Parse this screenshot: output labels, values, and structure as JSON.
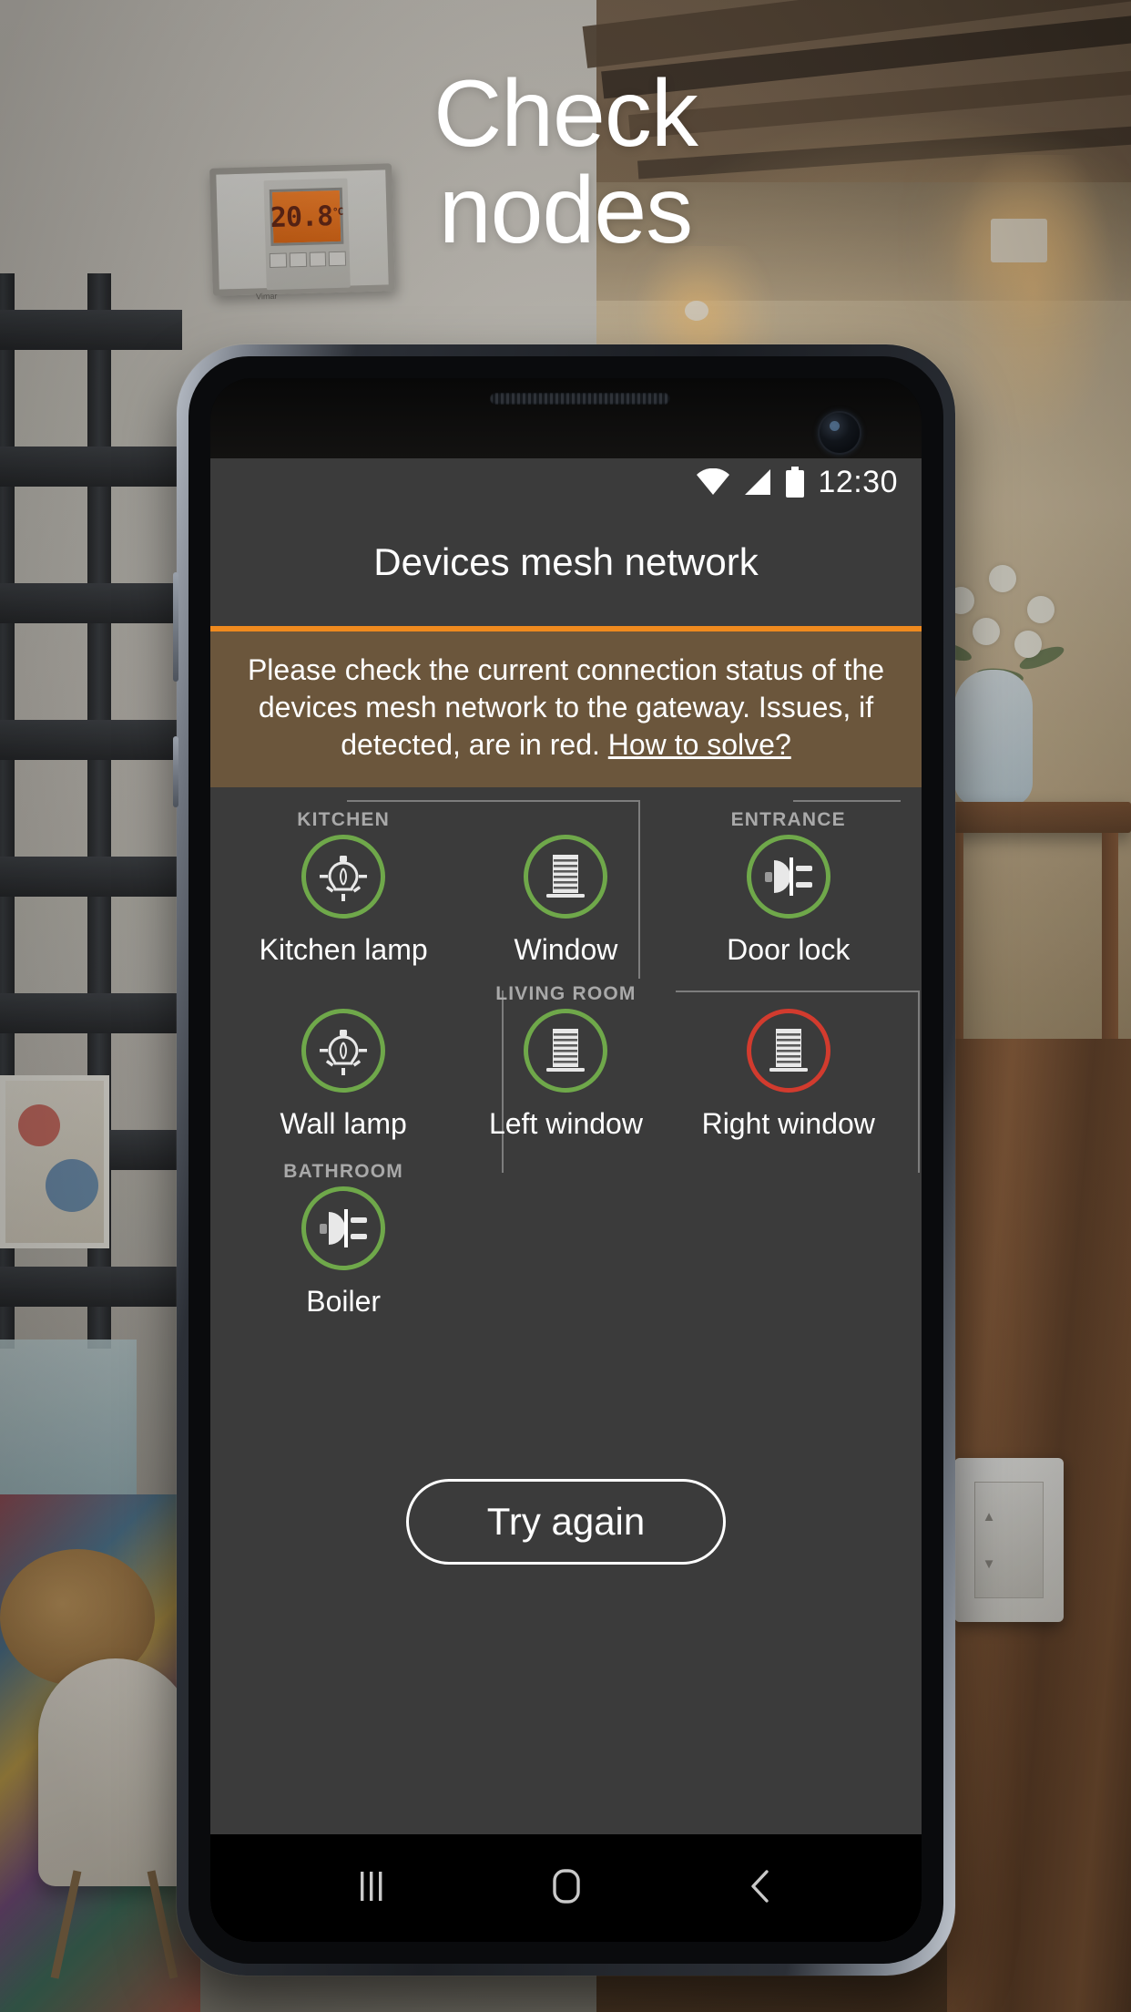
{
  "promo": {
    "headline_line1": "Check",
    "headline_line2": "nodes"
  },
  "background": {
    "thermostat_value": "20.8",
    "thermostat_unit": "°C",
    "thermostat_brand": "Vimar"
  },
  "phone": {
    "statusbar": {
      "wifi_icon": "wifi-icon",
      "signal_icon": "cell-signal-icon",
      "battery_icon": "battery-full-icon",
      "time": "12:30"
    },
    "app": {
      "title": "Devices mesh network",
      "banner": {
        "text": "Please check the current connection status of the devices mesh network to the gateway. Issues, if detected, are in red.",
        "link_label": "How to solve?",
        "accent_color": "#f08a1e",
        "background_color": "#6b563c"
      },
      "status_colors": {
        "ok": "#6fa84a",
        "error": "#d23b2e"
      },
      "groups": [
        {
          "name": "KITCHEN"
        },
        {
          "name": "ENTRANCE"
        },
        {
          "name": "LIVING ROOM"
        },
        {
          "name": "BATHROOM"
        }
      ],
      "nodes": [
        {
          "label": "Kitchen lamp",
          "icon": "bulb-icon",
          "status": "ok",
          "group": "KITCHEN"
        },
        {
          "label": "Window",
          "icon": "shutter-icon",
          "status": "ok",
          "group": "KITCHEN"
        },
        {
          "label": "Door lock",
          "icon": "plug-icon",
          "status": "ok",
          "group": "ENTRANCE"
        },
        {
          "label": "Wall lamp",
          "icon": "bulb-icon",
          "status": "ok",
          "group": ""
        },
        {
          "label": "Left window",
          "icon": "shutter-icon",
          "status": "ok",
          "group": "LIVING ROOM"
        },
        {
          "label": "Right window",
          "icon": "shutter-icon",
          "status": "error",
          "group": "LIVING ROOM"
        },
        {
          "label": "Boiler",
          "icon": "plug-icon",
          "status": "ok",
          "group": "BATHROOM"
        }
      ],
      "retry_button": "Try again"
    },
    "navbar": {
      "recents_icon": "recents-icon",
      "home_icon": "home-icon",
      "back_icon": "back-icon"
    }
  }
}
